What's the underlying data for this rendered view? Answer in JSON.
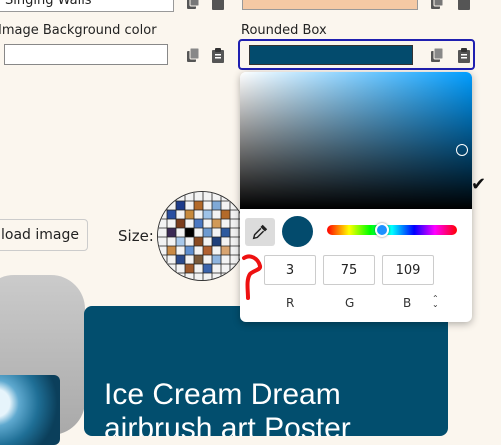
{
  "top_field": {
    "value": "Singing Walls"
  },
  "image_bg": {
    "label": "Image Background color",
    "value": ""
  },
  "rounded_box": {
    "label": "Rounded Box",
    "color": "#034b6d"
  },
  "upload_button": {
    "label": "load image"
  },
  "size_label": "Size:",
  "picker": {
    "selected_color": "#034b6d",
    "r": "3",
    "g": "75",
    "b": "109",
    "r_label": "R",
    "g_label": "G",
    "b_label": "B",
    "mode_toggle": "⌃⌄"
  },
  "poster": {
    "title_line1": "Ice Cream Dream",
    "title_line2": "airbrush art Poster"
  },
  "colors": {
    "page_bg": "#fbf6ee",
    "accent": "#1f1fb0",
    "poster_bg": "#024e6e",
    "top_swatch": "#f5c9a4"
  }
}
